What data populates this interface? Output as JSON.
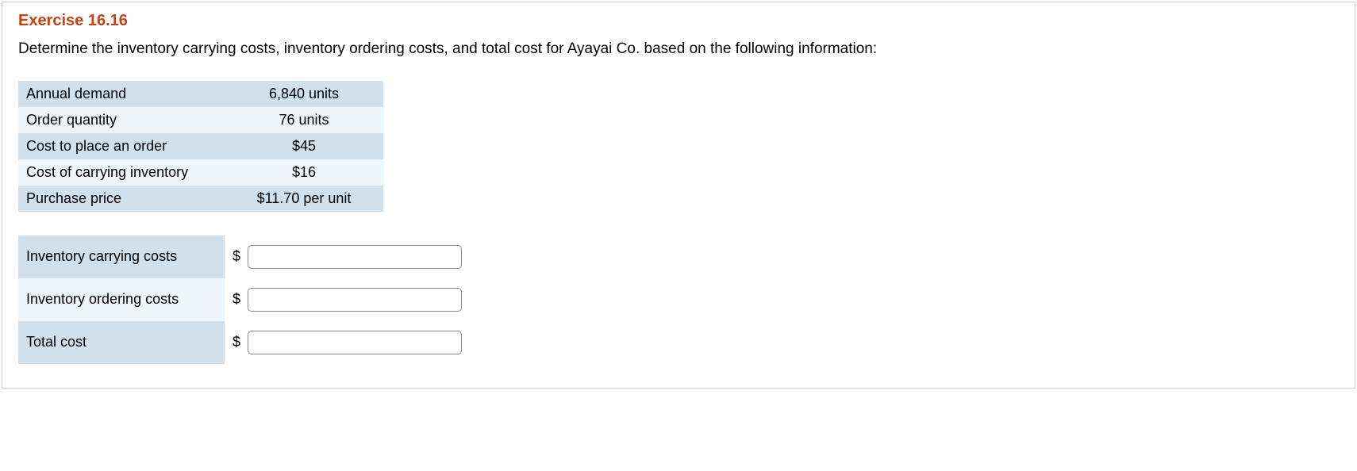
{
  "exercise": {
    "title": "Exercise 16.16",
    "prompt": "Determine the inventory carrying costs, inventory ordering costs, and total cost for Ayayai Co. based on the following information:"
  },
  "info_rows": [
    {
      "label": "Annual demand",
      "value": "6,840 units"
    },
    {
      "label": "Order quantity",
      "value": "76 units"
    },
    {
      "label": "Cost to place an order",
      "value": "$45"
    },
    {
      "label": "Cost of carrying inventory",
      "value": "$16"
    },
    {
      "label": "Purchase price",
      "value": "$11.70 per unit"
    }
  ],
  "answer_rows": [
    {
      "label": "Inventory carrying costs",
      "currency": "$",
      "value": ""
    },
    {
      "label": "Inventory ordering costs",
      "currency": "$",
      "value": ""
    },
    {
      "label": "Total cost",
      "currency": "$",
      "value": ""
    }
  ]
}
